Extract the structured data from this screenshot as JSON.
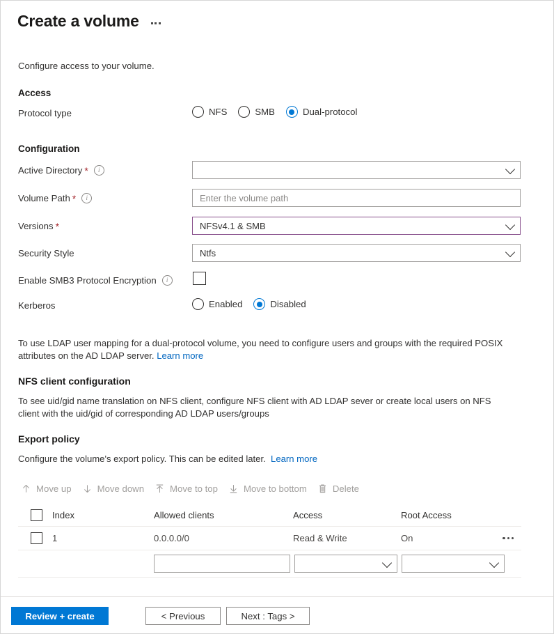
{
  "header": {
    "title": "Create a volume",
    "more_menu": "more-options"
  },
  "intro": "Configure access to your volume.",
  "access": {
    "heading": "Access",
    "protocol_label": "Protocol type",
    "options": [
      {
        "label": "NFS",
        "selected": false
      },
      {
        "label": "SMB",
        "selected": false
      },
      {
        "label": "Dual-protocol",
        "selected": true
      }
    ]
  },
  "configuration": {
    "heading": "Configuration",
    "active_directory": {
      "label": "Active Directory",
      "required": "*",
      "value": "",
      "placeholder": ""
    },
    "volume_path": {
      "label": "Volume Path",
      "required": "*",
      "value": "",
      "placeholder": "Enter the volume path"
    },
    "versions": {
      "label": "Versions",
      "required": "*",
      "value": "NFSv4.1 & SMB",
      "focus_border_color": "#874e8b"
    },
    "security_style": {
      "label": "Security Style",
      "value": "Ntfs"
    },
    "smb3_encryption": {
      "label": "Enable SMB3 Protocol Encryption",
      "checked": false
    },
    "kerberos": {
      "label": "Kerberos",
      "options": [
        {
          "label": "Enabled",
          "selected": false
        },
        {
          "label": "Disabled",
          "selected": true
        }
      ]
    }
  },
  "ldap_note": {
    "text_before": "To use LDAP user mapping for a dual-protocol volume, you need to configure users and groups with the required POSIX attributes on the AD LDAP server.",
    "link": "Learn more"
  },
  "nfs_client": {
    "heading": "NFS client configuration",
    "body": "To see uid/gid name translation on NFS client, configure NFS client with AD LDAP sever or create local users on NFS client with the uid/gid of corresponding AD LDAP users/groups"
  },
  "export_policy": {
    "heading": "Export policy",
    "description": "Configure the volume's export policy. This can be edited later.",
    "link": "Learn more",
    "toolbar": [
      {
        "label": "Move up",
        "icon": "arrow-up-icon",
        "disabled": true
      },
      {
        "label": "Move down",
        "icon": "arrow-down-icon",
        "disabled": true
      },
      {
        "label": "Move to top",
        "icon": "arrow-to-top-icon",
        "disabled": true
      },
      {
        "label": "Move to bottom",
        "icon": "arrow-to-bottom-icon",
        "disabled": true
      },
      {
        "label": "Delete",
        "icon": "trash-icon",
        "disabled": true
      }
    ],
    "table": {
      "columns": [
        "Index",
        "Allowed clients",
        "Access",
        "Root Access"
      ],
      "rows": [
        {
          "index": "1",
          "allowed_clients": "0.0.0.0/0",
          "access": "Read & Write",
          "root_access": "On",
          "checked": false
        }
      ],
      "new_row": {
        "allowed_clients": "",
        "access": "",
        "root_access": ""
      }
    }
  },
  "footer": {
    "review_create": "Review + create",
    "previous": "< Previous",
    "next": "Next : Tags >",
    "primary_color": "#0078d4"
  }
}
